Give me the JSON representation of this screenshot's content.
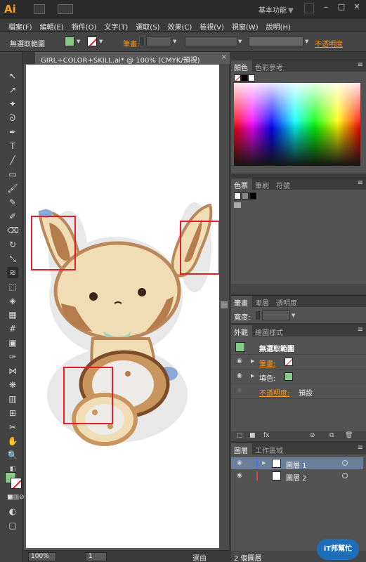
{
  "app": {
    "logo": "Ai",
    "workspace": "基本功能",
    "workspace_arrow": "▼"
  },
  "menu": [
    "檔案(F)",
    "編輯(E)",
    "物件(O)",
    "文字(T)",
    "選取(S)",
    "效果(C)",
    "檢視(V)",
    "視窗(W)",
    "說明(H)"
  ],
  "control": {
    "selection_label": "無選取範圍",
    "fill_color": "#87c986",
    "stroke_label": "筆畫:",
    "opacity_label": "不透明度"
  },
  "document": {
    "tab_title": "GIRL+COLOR+SKILL.ai* @ 100% (CMYK/預視)",
    "close": "×"
  },
  "status": {
    "zoom": "100%",
    "page": "1",
    "state": "選曲"
  },
  "panels": {
    "color": {
      "tabs": [
        "顏色",
        "色彩參考"
      ]
    },
    "swatches": {
      "tabs": [
        "色票",
        "筆刷",
        "符號"
      ]
    },
    "stroke": {
      "tabs": [
        "筆畫",
        "漸層",
        "透明度"
      ],
      "weight_label": "寬度:"
    },
    "appearance": {
      "tabs": [
        "外觀",
        "繪圖樣式"
      ],
      "header": "無選取範圍",
      "stroke_label": "筆畫:",
      "fill_label": "填色:",
      "opacity_label": "不透明度:",
      "opacity_value": "預設",
      "header_color": "#87c986",
      "fill_color": "#87c986"
    },
    "layers": {
      "tabs": [
        "圖層",
        "工作區域"
      ],
      "items": [
        {
          "name": "圖層 1",
          "bar_color": "#4d6fff"
        },
        {
          "name": "圖層 2",
          "bar_color": "#e04040"
        }
      ],
      "count": "2 個圖層"
    }
  },
  "watermark": {
    "text": "iT邦幫忙"
  },
  "highlight_color": "#e0202a"
}
